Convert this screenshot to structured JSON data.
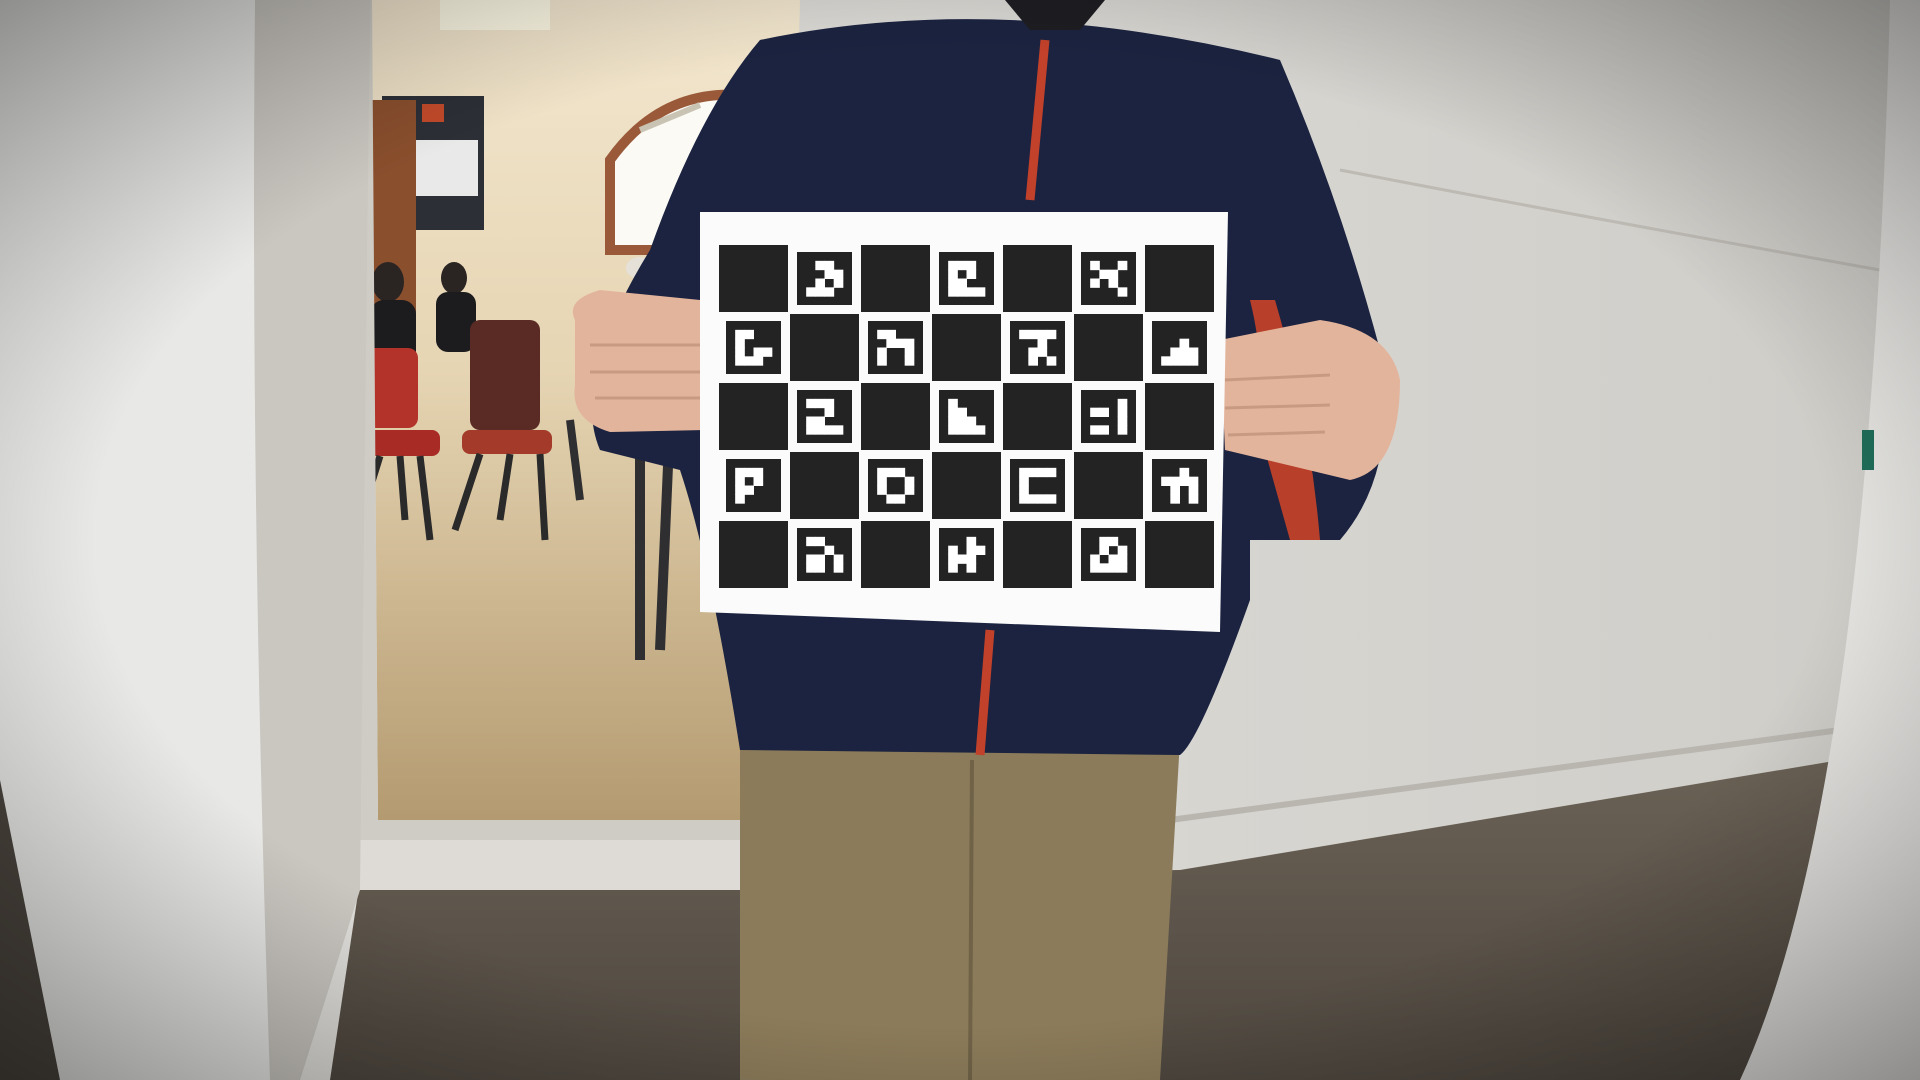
{
  "scene": {
    "description_colors": {
      "wall": "#dcdad5",
      "floor": "#5a5248",
      "hoodie": "#1a2340",
      "hoodie_accent": "#c2412a",
      "pants": "#8a7a58",
      "skin": "#e7b9a2",
      "board_white": "#ffffff",
      "board_black": "#232323",
      "room_floor": "#b39a72",
      "chair_red": "#b3332a"
    },
    "board": {
      "rows": 5,
      "cols": 7,
      "markers": [
        [
          1,
          1,
          [
            [
              0,
              1,
              1,
              0
            ],
            [
              0,
              0,
              1,
              1
            ],
            [
              0,
              1,
              0,
              1
            ],
            [
              1,
              1,
              1,
              0
            ]
          ]
        ],
        [
          1,
          3,
          [
            [
              1,
              1,
              1,
              0
            ],
            [
              1,
              0,
              1,
              0
            ],
            [
              1,
              1,
              0,
              0
            ],
            [
              1,
              1,
              1,
              1
            ]
          ]
        ],
        [
          1,
          5,
          [
            [
              1,
              0,
              0,
              1
            ],
            [
              0,
              1,
              1,
              0
            ],
            [
              1,
              0,
              1,
              0
            ],
            [
              0,
              0,
              0,
              1
            ]
          ]
        ],
        [
          2,
          0,
          [
            [
              1,
              1,
              0,
              0
            ],
            [
              1,
              0,
              0,
              0
            ],
            [
              1,
              0,
              1,
              1
            ],
            [
              1,
              1,
              1,
              0
            ]
          ]
        ],
        [
          2,
          2,
          [
            [
              1,
              1,
              0,
              0
            ],
            [
              0,
              1,
              1,
              1
            ],
            [
              1,
              0,
              0,
              1
            ],
            [
              1,
              0,
              0,
              1
            ]
          ]
        ],
        [
          2,
          4,
          [
            [
              1,
              1,
              1,
              1
            ],
            [
              0,
              0,
              1,
              0
            ],
            [
              0,
              1,
              1,
              0
            ],
            [
              0,
              1,
              0,
              1
            ]
          ]
        ],
        [
          2,
          6,
          [
            [
              0,
              0,
              0,
              0
            ],
            [
              0,
              0,
              1,
              0
            ],
            [
              0,
              1,
              1,
              1
            ],
            [
              1,
              1,
              1,
              1
            ]
          ]
        ],
        [
          3,
          1,
          [
            [
              1,
              1,
              1,
              0
            ],
            [
              0,
              0,
              1,
              0
            ],
            [
              1,
              1,
              0,
              0
            ],
            [
              1,
              1,
              1,
              1
            ]
          ]
        ],
        [
          3,
          3,
          [
            [
              1,
              0,
              0,
              0
            ],
            [
              1,
              1,
              0,
              0
            ],
            [
              1,
              1,
              1,
              0
            ],
            [
              1,
              1,
              1,
              1
            ]
          ]
        ],
        [
          3,
          5,
          [
            [
              0,
              0,
              0,
              1
            ],
            [
              1,
              1,
              0,
              1
            ],
            [
              0,
              0,
              0,
              1
            ],
            [
              1,
              1,
              0,
              1
            ]
          ]
        ],
        [
          4,
          0,
          [
            [
              1,
              1,
              1,
              0
            ],
            [
              1,
              0,
              1,
              0
            ],
            [
              1,
              1,
              0,
              0
            ],
            [
              1,
              0,
              0,
              0
            ]
          ]
        ],
        [
          4,
          2,
          [
            [
              1,
              1,
              1,
              0
            ],
            [
              1,
              0,
              0,
              1
            ],
            [
              1,
              0,
              0,
              1
            ],
            [
              0,
              1,
              1,
              0
            ]
          ]
        ],
        [
          4,
          4,
          [
            [
              1,
              1,
              1,
              1
            ],
            [
              1,
              0,
              0,
              0
            ],
            [
              1,
              0,
              0,
              0
            ],
            [
              1,
              1,
              1,
              1
            ]
          ]
        ],
        [
          4,
          6,
          [
            [
              0,
              0,
              1,
              0
            ],
            [
              1,
              1,
              1,
              1
            ],
            [
              0,
              1,
              0,
              1
            ],
            [
              0,
              1,
              0,
              1
            ]
          ]
        ],
        [
          5,
          1,
          [
            [
              1,
              1,
              0,
              0
            ],
            [
              0,
              0,
              1,
              0
            ],
            [
              1,
              1,
              0,
              1
            ],
            [
              1,
              1,
              0,
              1
            ]
          ]
        ],
        [
          5,
          3,
          [
            [
              0,
              0,
              1,
              0
            ],
            [
              1,
              0,
              1,
              1
            ],
            [
              1,
              1,
              1,
              0
            ],
            [
              1,
              0,
              1,
              0
            ]
          ]
        ],
        [
          5,
          5,
          [
            [
              0,
              1,
              1,
              0
            ],
            [
              0,
              1,
              0,
              1
            ],
            [
              1,
              0,
              1,
              1
            ],
            [
              1,
              1,
              1,
              1
            ]
          ]
        ]
      ]
    }
  }
}
